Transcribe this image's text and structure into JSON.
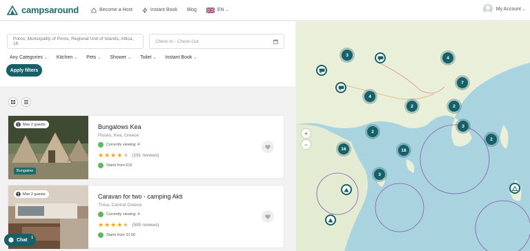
{
  "header": {
    "brand": "campsaround",
    "nav": {
      "become_host": "Become a Host",
      "instant_book": "Instant Book",
      "blog": "Blog",
      "language": "EN"
    },
    "account": "My Account"
  },
  "search": {
    "location_value": "Poros, Municipality of Poros, Regional Unit of Islands, Attica, 18",
    "dates_placeholder": "Check-In - Check-Out"
  },
  "filters": {
    "items": [
      "Any Categories",
      "Kitchen",
      "Pets",
      "Shower",
      "Toilet",
      "Instant Book"
    ],
    "apply_label": "Apply filters"
  },
  "listings": [
    {
      "title": "Bungalows Kea",
      "location": "Pisses, Kea, Greece",
      "guests": "Max 2 guests",
      "type": "Bungalow",
      "viewing": "Currently viewing: 4",
      "rating": 4,
      "reviews": "(191 reviews)",
      "price": "Starts from 61€"
    },
    {
      "title": "Caravan for two - camping Akti",
      "location": "Thiva, Central Greece",
      "guests": "Max 2 guests",
      "type": "",
      "viewing": "Currently viewing: 4",
      "rating": 4.5,
      "reviews": "(595 reviews)",
      "price": "Starts from 31.5€"
    }
  ],
  "chat": {
    "label": "Chat",
    "count": "1"
  },
  "map": {
    "clusters": [
      "3",
      "4",
      "7",
      "4",
      "2",
      "2",
      "3",
      "2",
      "2",
      "16",
      "18",
      "3"
    ],
    "zoom_in": "+",
    "zoom_out": "−"
  },
  "colors": {
    "accent": "#16606a",
    "brand": "#1f6b6b",
    "star": "#f0a500",
    "map_water": "#a9d3df",
    "map_land": "#e9efd9"
  }
}
